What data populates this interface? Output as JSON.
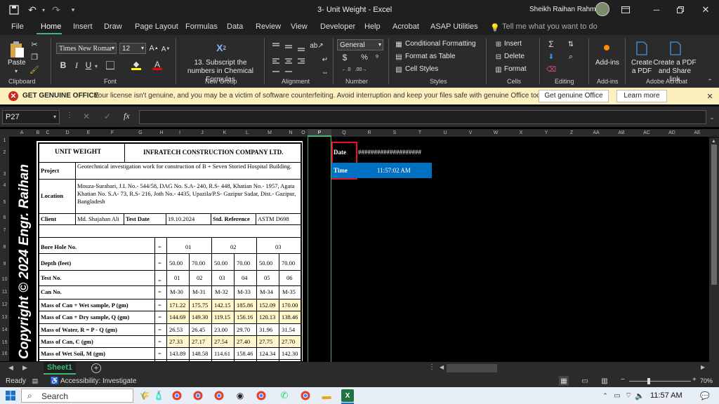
{
  "window": {
    "title": "3- Unit Weight  -  Excel",
    "user": "Sheikh Raihan Rahman"
  },
  "tabs": [
    "File",
    "Home",
    "Insert",
    "Draw",
    "Page Layout",
    "Formulas",
    "Data",
    "Review",
    "View",
    "Developer",
    "Help",
    "Acrobat",
    "ASAP Utilities"
  ],
  "tell_me": "Tell me what you want to do",
  "ribbon": {
    "paste": "Paste",
    "font_name": "Times New Romar",
    "font_size": "12",
    "subscript": "13. Subscript the numbers in Chemical Formulas",
    "number_format": "General",
    "cond_format": "Conditional Formatting",
    "format_table": "Format as Table",
    "cell_styles": "Cell Styles",
    "insert": "Insert",
    "delete": "Delete",
    "format": "Format",
    "addins": "Add-ins",
    "create_pdf": "Create a PDF",
    "create_share": "Create a PDF and Share link",
    "groups": [
      "Clipboard",
      "Font",
      "New Group",
      "Alignment",
      "Number",
      "Styles",
      "Cells",
      "Editing",
      "Add-ins",
      "Adobe Acrobat"
    ]
  },
  "message": {
    "label": "GET GENUINE OFFICE",
    "text": "Your license isn't genuine, and you may be a victim of software counterfeiting. Avoid interruption and keep your files safe with genuine Office today.",
    "btn1": "Get genuine Office",
    "btn2": "Learn more"
  },
  "formula": {
    "namebox": "P27",
    "fx": "fx"
  },
  "columns": [
    "A",
    "B",
    "C",
    "D",
    "E",
    "F",
    "G",
    "H",
    "I",
    "J",
    "K",
    "L",
    "M",
    "N",
    "O",
    "P",
    "Q",
    "R",
    "S",
    "T",
    "U",
    "V",
    "W",
    "X",
    "Y",
    "Z",
    "AA",
    "AB",
    "AC",
    "AD",
    "AE"
  ],
  "rows": [
    "1",
    "2",
    "3",
    "4",
    "5",
    "6",
    "7",
    "8",
    "9",
    "10",
    "11",
    "12",
    "13",
    "14",
    "15",
    "16"
  ],
  "watermark": "Copyright © 2024 Engr. Raihan",
  "sheet": {
    "title": "UNIT WEIGHT",
    "company": "INFRATECH CONSTRUCTION COMPANY LTD.",
    "project_label": "Project",
    "project": "Geotechnical investigation work for construction of B + Seven Storied Hospital Building.",
    "location_label": "Location",
    "location": "Mouza-Surabari, J.L No.- 544/58, DAG No. S.A- 240, R.S- 448, Khatian No.- 1957, Agata Khatian No. S.A- 73, R.S- 216, Joth No.- 4435, Upazila/P.S- Gazipur Sadar, Dist.- Gazipur, Bangladesh",
    "client_label": "Client",
    "client": "Md. Shajahan Ali",
    "test_date_label": "Test Date",
    "test_date": "19.10.2024",
    "std_label": "Std. Reference",
    "std": "ASTM D698",
    "table": [
      {
        "label": "Bore Hole No.",
        "eq": "=",
        "vals": [
          "01",
          "",
          "02",
          "",
          "03",
          ""
        ]
      },
      {
        "label": "Depth (feet)",
        "eq": "=",
        "vals": [
          "50.00",
          "70.00",
          "50.00",
          "70.00",
          "50.00",
          "70.00"
        ]
      },
      {
        "label": "Test No.",
        "eq": "=",
        "vals": [
          "01",
          "02",
          "03",
          "04",
          "05",
          "06"
        ]
      },
      {
        "label": "Can No.",
        "eq": "=",
        "vals": [
          "M-30",
          "M-31",
          "M-32",
          "M-33",
          "M-34",
          "M-35"
        ]
      },
      {
        "label": "Mass of Can + Wet sample, P (gm)",
        "eq": "=",
        "vals": [
          "171.22",
          "175.75",
          "142.15",
          "185.86",
          "152.09",
          "170.00"
        ]
      },
      {
        "label": "Mass of Can + Dry sample, Q (gm)",
        "eq": "=",
        "vals": [
          "144.69",
          "149.30",
          "119.15",
          "156.16",
          "120.13",
          "138.46"
        ]
      },
      {
        "label": "Mass of Water, R = P - Q (gm)",
        "eq": "=",
        "vals": [
          "26.53",
          "26.45",
          "23.00",
          "29.70",
          "31.96",
          "31.54"
        ]
      },
      {
        "label": "Mass of Can, C (gm)",
        "eq": "=",
        "vals": [
          "27.33",
          "27.17",
          "27.54",
          "27.40",
          "27.75",
          "27.70"
        ]
      },
      {
        "label": "Mass of Wet Soil, M (gm)",
        "eq": "=",
        "vals": [
          "143.89",
          "148.58",
          "114.61",
          "158.46",
          "124.34",
          "142.30"
        ]
      }
    ]
  },
  "side": {
    "date_label": "Date",
    "date_value": "####################",
    "time_label": "Time",
    "time_value": "11:57:02 AM"
  },
  "sheet_tab": "Sheet1",
  "status": {
    "ready": "Ready",
    "access": "Accessibility: Investigate",
    "zoom": "70%"
  },
  "taskbar": {
    "search": "Search",
    "time": "11:57 AM"
  },
  "colors": {
    "excel_green": "#217346",
    "blue_fill": "#0070c0",
    "yellow": "#fff7c9"
  }
}
